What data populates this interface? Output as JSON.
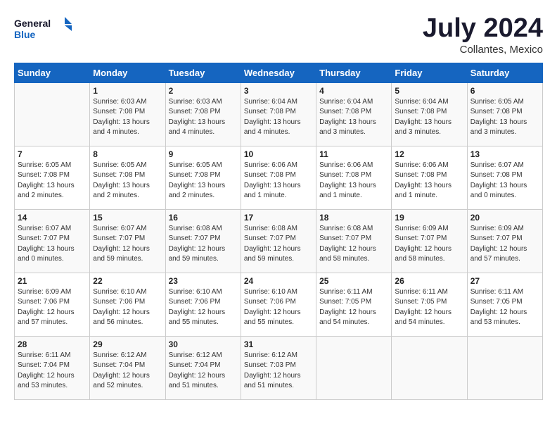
{
  "header": {
    "logo_line1": "General",
    "logo_line2": "Blue",
    "month": "July 2024",
    "location": "Collantes, Mexico"
  },
  "days_of_week": [
    "Sunday",
    "Monday",
    "Tuesday",
    "Wednesday",
    "Thursday",
    "Friday",
    "Saturday"
  ],
  "weeks": [
    [
      {
        "day": "",
        "content": ""
      },
      {
        "day": "1",
        "content": "Sunrise: 6:03 AM\nSunset: 7:08 PM\nDaylight: 13 hours\nand 4 minutes."
      },
      {
        "day": "2",
        "content": "Sunrise: 6:03 AM\nSunset: 7:08 PM\nDaylight: 13 hours\nand 4 minutes."
      },
      {
        "day": "3",
        "content": "Sunrise: 6:04 AM\nSunset: 7:08 PM\nDaylight: 13 hours\nand 4 minutes."
      },
      {
        "day": "4",
        "content": "Sunrise: 6:04 AM\nSunset: 7:08 PM\nDaylight: 13 hours\nand 3 minutes."
      },
      {
        "day": "5",
        "content": "Sunrise: 6:04 AM\nSunset: 7:08 PM\nDaylight: 13 hours\nand 3 minutes."
      },
      {
        "day": "6",
        "content": "Sunrise: 6:05 AM\nSunset: 7:08 PM\nDaylight: 13 hours\nand 3 minutes."
      }
    ],
    [
      {
        "day": "7",
        "content": "Sunrise: 6:05 AM\nSunset: 7:08 PM\nDaylight: 13 hours\nand 2 minutes."
      },
      {
        "day": "8",
        "content": "Sunrise: 6:05 AM\nSunset: 7:08 PM\nDaylight: 13 hours\nand 2 minutes."
      },
      {
        "day": "9",
        "content": "Sunrise: 6:05 AM\nSunset: 7:08 PM\nDaylight: 13 hours\nand 2 minutes."
      },
      {
        "day": "10",
        "content": "Sunrise: 6:06 AM\nSunset: 7:08 PM\nDaylight: 13 hours\nand 1 minute."
      },
      {
        "day": "11",
        "content": "Sunrise: 6:06 AM\nSunset: 7:08 PM\nDaylight: 13 hours\nand 1 minute."
      },
      {
        "day": "12",
        "content": "Sunrise: 6:06 AM\nSunset: 7:08 PM\nDaylight: 13 hours\nand 1 minute."
      },
      {
        "day": "13",
        "content": "Sunrise: 6:07 AM\nSunset: 7:08 PM\nDaylight: 13 hours\nand 0 minutes."
      }
    ],
    [
      {
        "day": "14",
        "content": "Sunrise: 6:07 AM\nSunset: 7:07 PM\nDaylight: 13 hours\nand 0 minutes."
      },
      {
        "day": "15",
        "content": "Sunrise: 6:07 AM\nSunset: 7:07 PM\nDaylight: 12 hours\nand 59 minutes."
      },
      {
        "day": "16",
        "content": "Sunrise: 6:08 AM\nSunset: 7:07 PM\nDaylight: 12 hours\nand 59 minutes."
      },
      {
        "day": "17",
        "content": "Sunrise: 6:08 AM\nSunset: 7:07 PM\nDaylight: 12 hours\nand 59 minutes."
      },
      {
        "day": "18",
        "content": "Sunrise: 6:08 AM\nSunset: 7:07 PM\nDaylight: 12 hours\nand 58 minutes."
      },
      {
        "day": "19",
        "content": "Sunrise: 6:09 AM\nSunset: 7:07 PM\nDaylight: 12 hours\nand 58 minutes."
      },
      {
        "day": "20",
        "content": "Sunrise: 6:09 AM\nSunset: 7:07 PM\nDaylight: 12 hours\nand 57 minutes."
      }
    ],
    [
      {
        "day": "21",
        "content": "Sunrise: 6:09 AM\nSunset: 7:06 PM\nDaylight: 12 hours\nand 57 minutes."
      },
      {
        "day": "22",
        "content": "Sunrise: 6:10 AM\nSunset: 7:06 PM\nDaylight: 12 hours\nand 56 minutes."
      },
      {
        "day": "23",
        "content": "Sunrise: 6:10 AM\nSunset: 7:06 PM\nDaylight: 12 hours\nand 55 minutes."
      },
      {
        "day": "24",
        "content": "Sunrise: 6:10 AM\nSunset: 7:06 PM\nDaylight: 12 hours\nand 55 minutes."
      },
      {
        "day": "25",
        "content": "Sunrise: 6:11 AM\nSunset: 7:05 PM\nDaylight: 12 hours\nand 54 minutes."
      },
      {
        "day": "26",
        "content": "Sunrise: 6:11 AM\nSunset: 7:05 PM\nDaylight: 12 hours\nand 54 minutes."
      },
      {
        "day": "27",
        "content": "Sunrise: 6:11 AM\nSunset: 7:05 PM\nDaylight: 12 hours\nand 53 minutes."
      }
    ],
    [
      {
        "day": "28",
        "content": "Sunrise: 6:11 AM\nSunset: 7:04 PM\nDaylight: 12 hours\nand 53 minutes."
      },
      {
        "day": "29",
        "content": "Sunrise: 6:12 AM\nSunset: 7:04 PM\nDaylight: 12 hours\nand 52 minutes."
      },
      {
        "day": "30",
        "content": "Sunrise: 6:12 AM\nSunset: 7:04 PM\nDaylight: 12 hours\nand 51 minutes."
      },
      {
        "day": "31",
        "content": "Sunrise: 6:12 AM\nSunset: 7:03 PM\nDaylight: 12 hours\nand 51 minutes."
      },
      {
        "day": "",
        "content": ""
      },
      {
        "day": "",
        "content": ""
      },
      {
        "day": "",
        "content": ""
      }
    ]
  ]
}
